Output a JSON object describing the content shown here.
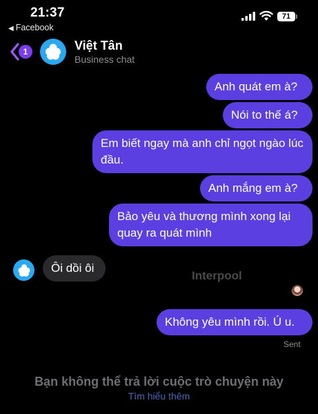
{
  "status_bar": {
    "time": "21:37",
    "back_app": "Facebook",
    "battery": "71"
  },
  "header": {
    "badge_count": "1",
    "contact_name": "Việt Tân",
    "contact_subtitle": "Business chat"
  },
  "messages": [
    {
      "direction": "outgoing",
      "text": "Anh quát em à?"
    },
    {
      "direction": "outgoing",
      "text": "Nói to thế á?"
    },
    {
      "direction": "outgoing",
      "text": "Em biết ngay mà anh chỉ ngọt ngào lúc đầu."
    },
    {
      "direction": "outgoing",
      "text": "Anh mắng em à?"
    },
    {
      "direction": "outgoing",
      "text": "Bảo yêu và thương mình xong lại quay ra quát mình"
    },
    {
      "direction": "incoming",
      "text": "Ôi dồi ôi"
    },
    {
      "direction": "outgoing",
      "text": "Không yêu mình rồi. Ú u."
    }
  ],
  "watermark": "Interpool",
  "sent_label": "Sent",
  "footer": {
    "notice": "Bạn không thể trả lời cuộc trò chuyện này",
    "learn_more": "Tìm hiểu thêm"
  },
  "colors": {
    "outgoing_bubble": "#5b3fe0",
    "incoming_bubble": "#2a2a2c",
    "accent": "#7a3df0",
    "avatar_bg": "#29a9f2"
  }
}
